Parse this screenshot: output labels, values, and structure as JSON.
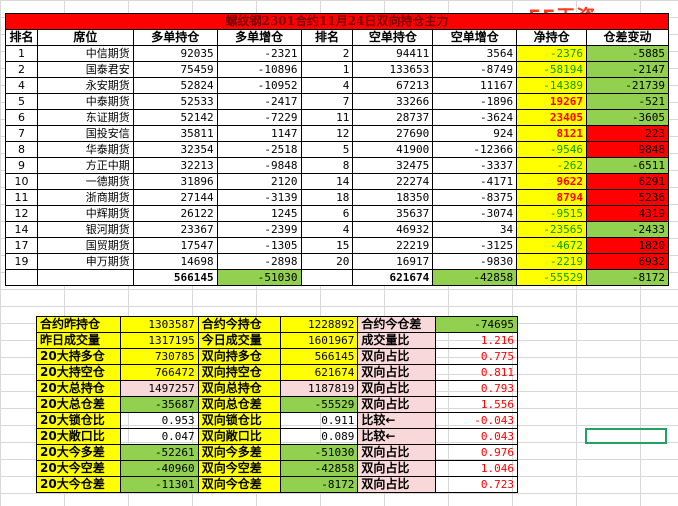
{
  "title": "螺纹钢2301合约11月24日双向持仓主力",
  "watermark": "5E天资5etz.com",
  "headers": [
    "排名",
    "席位",
    "多单持仓",
    "多单增仓",
    "排名",
    "空单持仓",
    "空单增仓",
    "净持仓",
    "仓差变动"
  ],
  "rows": [
    {
      "rank": "1",
      "broker": "中信期货",
      "long": "92035",
      "long_chg": "-2321",
      "srank": "2",
      "short": "94411",
      "short_chg": "3564",
      "net": "-2376",
      "diff": "-5885",
      "net_sign": "neg",
      "diff_sign": "neg"
    },
    {
      "rank": "2",
      "broker": "国泰君安",
      "long": "75459",
      "long_chg": "-10896",
      "srank": "1",
      "short": "133653",
      "short_chg": "-8749",
      "net": "-58194",
      "diff": "-2147",
      "net_sign": "neg",
      "diff_sign": "neg"
    },
    {
      "rank": "4",
      "broker": "永安期货",
      "long": "52824",
      "long_chg": "-10952",
      "srank": "4",
      "short": "67213",
      "short_chg": "11167",
      "net": "-14389",
      "diff": "-21739",
      "net_sign": "neg",
      "diff_sign": "neg"
    },
    {
      "rank": "5",
      "broker": "中泰期货",
      "long": "52533",
      "long_chg": "-2417",
      "srank": "7",
      "short": "33266",
      "short_chg": "-1896",
      "net": "19267",
      "diff": "-521",
      "net_sign": "pos",
      "diff_sign": "neg"
    },
    {
      "rank": "6",
      "broker": "东证期货",
      "long": "52142",
      "long_chg": "-7229",
      "srank": "11",
      "short": "28737",
      "short_chg": "-3624",
      "net": "23405",
      "diff": "-3605",
      "net_sign": "pos",
      "diff_sign": "neg"
    },
    {
      "rank": "7",
      "broker": "国投安信",
      "long": "35811",
      "long_chg": "1147",
      "srank": "12",
      "short": "27690",
      "short_chg": "924",
      "net": "8121",
      "diff": "223",
      "net_sign": "pos",
      "diff_sign": "pos"
    },
    {
      "rank": "8",
      "broker": "华泰期货",
      "long": "32354",
      "long_chg": "-2518",
      "srank": "5",
      "short": "41900",
      "short_chg": "-12366",
      "net": "-9546",
      "diff": "9848",
      "net_sign": "neg",
      "diff_sign": "pos"
    },
    {
      "rank": "9",
      "broker": "方正中期",
      "long": "32213",
      "long_chg": "-9848",
      "srank": "8",
      "short": "32475",
      "short_chg": "-3337",
      "net": "-262",
      "diff": "-6511",
      "net_sign": "neg",
      "diff_sign": "neg"
    },
    {
      "rank": "10",
      "broker": "一德期货",
      "long": "31896",
      "long_chg": "2120",
      "srank": "14",
      "short": "22274",
      "short_chg": "-4171",
      "net": "9622",
      "diff": "6291",
      "net_sign": "pos",
      "diff_sign": "pos"
    },
    {
      "rank": "11",
      "broker": "浙商期货",
      "long": "27144",
      "long_chg": "-3139",
      "srank": "18",
      "short": "18350",
      "short_chg": "-8375",
      "net": "8794",
      "diff": "5236",
      "net_sign": "pos",
      "diff_sign": "pos"
    },
    {
      "rank": "12",
      "broker": "中辉期货",
      "long": "26122",
      "long_chg": "1245",
      "srank": "6",
      "short": "35637",
      "short_chg": "-3074",
      "net": "-9515",
      "diff": "4319",
      "net_sign": "neg",
      "diff_sign": "pos"
    },
    {
      "rank": "14",
      "broker": "银河期货",
      "long": "23367",
      "long_chg": "-2399",
      "srank": "4",
      "short": "46932",
      "short_chg": "34",
      "net": "-23565",
      "diff": "-2433",
      "net_sign": "neg",
      "diff_sign": "neg"
    },
    {
      "rank": "17",
      "broker": "国贸期货",
      "long": "17547",
      "long_chg": "-1305",
      "srank": "15",
      "short": "22219",
      "short_chg": "-3125",
      "net": "-4672",
      "diff": "1820",
      "net_sign": "neg",
      "diff_sign": "pos"
    },
    {
      "rank": "19",
      "broker": "申万期货",
      "long": "14698",
      "long_chg": "-2898",
      "srank": "20",
      "short": "16917",
      "short_chg": "-9830",
      "net": "-2219",
      "diff": "6932",
      "net_sign": "neg",
      "diff_sign": "pos"
    }
  ],
  "totals": {
    "long": "566145",
    "long_chg": "-51030",
    "short": "621674",
    "short_chg": "-42858",
    "net": "-55529",
    "diff": "-8172"
  },
  "summary": [
    {
      "l1": "合约昨持仓",
      "v1": "1303587",
      "c1": "yel",
      "l2": "合约今持仓",
      "v2": "1228892",
      "c2": "yel",
      "l3": "合约今仓差",
      "v3": "-74695",
      "c3": "grn",
      "v3red": false
    },
    {
      "l1": "昨日成交量",
      "v1": "1317195",
      "c1": "yel",
      "l2": "今日成交量",
      "v2": "1601967",
      "c2": "yel",
      "l3": "成交量比",
      "v3": "1.216",
      "c3": "",
      "v3red": true
    },
    {
      "l1": "20大持多仓",
      "v1": "730785",
      "c1": "yel",
      "l2": "双向持多仓",
      "v2": "566145",
      "c2": "yel",
      "l3": "双向占比",
      "v3": "0.775",
      "c3": "",
      "v3red": true
    },
    {
      "l1": "20大持空仓",
      "v1": "766472",
      "c1": "yel",
      "l2": "双向持空仓",
      "v2": "621674",
      "c2": "yel",
      "l3": "双向占比",
      "v3": "0.811",
      "c3": "",
      "v3red": true
    },
    {
      "l1": "20大总持仓",
      "v1": "1497257",
      "c1": "pink",
      "l2": "双向总持仓",
      "v2": "1187819",
      "c2": "pink",
      "l3": "双向占比",
      "v3": "0.793",
      "c3": "",
      "v3red": true
    },
    {
      "l1": "20大总仓差",
      "v1": "-35687",
      "c1": "grn",
      "l2": "双向总仓差",
      "v2": "-55529",
      "c2": "grn",
      "l3": "双向占比",
      "v3": "1.556",
      "c3": "",
      "v3red": true
    },
    {
      "l1": "20大锁仓比",
      "v1": "0.953",
      "c1": "",
      "l2": "双向锁仓比",
      "v2": "0.911",
      "c2": "",
      "l3": "比较←",
      "v3": "-0.043",
      "c3": "",
      "v3red": true
    },
    {
      "l1": "20大敞口比",
      "v1": "0.047",
      "c1": "",
      "l2": "双向敞口比",
      "v2": "0.089",
      "c2": "",
      "l3": "比较←",
      "v3": "0.043",
      "c3": "",
      "v3red": true
    },
    {
      "l1": "20大今多差",
      "v1": "-52261",
      "c1": "grn",
      "l2": "双向今多差",
      "v2": "-51030",
      "c2": "grn",
      "l3": "双向占比",
      "v3": "0.976",
      "c3": "",
      "v3red": true
    },
    {
      "l1": "20大今空差",
      "v1": "-40960",
      "c1": "grn",
      "l2": "双向今空差",
      "v2": "-42858",
      "c2": "grn",
      "l3": "双向占比",
      "v3": "1.046",
      "c3": "",
      "v3red": true
    },
    {
      "l1": "20大今仓差",
      "v1": "-11301",
      "c1": "grn",
      "l2": "双向今仓差",
      "v2": "-8172",
      "c2": "grn",
      "l3": "双向占比",
      "v3": "0.723",
      "c3": "",
      "v3red": true
    }
  ]
}
